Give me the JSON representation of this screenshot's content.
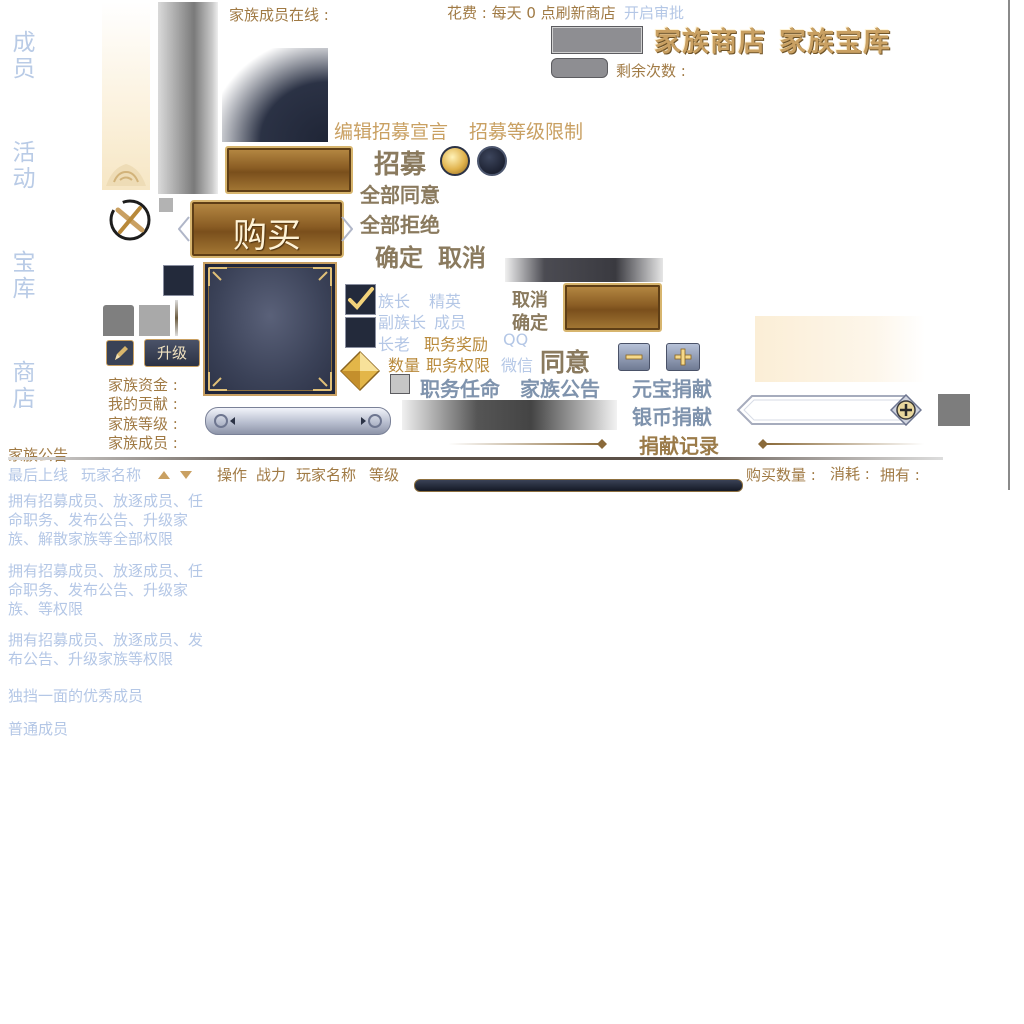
{
  "left_tabs": [
    {
      "chars": [
        "成",
        "员"
      ]
    },
    {
      "chars": [
        "活",
        "动"
      ]
    },
    {
      "chars": [
        "宝",
        "库"
      ]
    },
    {
      "chars": [
        "商",
        "店"
      ]
    }
  ],
  "header": {
    "online_label": "家族成员在线 :",
    "cost_text": "花费 : 每天 0 点刷新商店",
    "open_review": "开启审批",
    "shop_title": "家族商店",
    "treasury_title": "家族宝库",
    "remaining_label": "剩余次数 :"
  },
  "recruit": {
    "edit_declaration": "编辑招募宣言",
    "level_limit": "招募等级限制",
    "recruit_label": "招募",
    "approve_all": "全部同意",
    "reject_all": "全部拒绝",
    "buy": "购买",
    "confirm": "确定",
    "cancel": "取消"
  },
  "roles": {
    "leader": "族长",
    "elite": "精英",
    "vice_leader": "副族长",
    "member": "成员",
    "elder": "长老",
    "position_reward": "职务奖励",
    "qq": "QQ",
    "quantity": "数量",
    "position_perm": "职务权限",
    "wechat": "微信"
  },
  "dialog": {
    "cancel_small": "取消",
    "confirm_small": "确定",
    "agree": "同意",
    "appoint": "职务任命",
    "announcement_tab": "家族公告",
    "yuanbao_donate": "元宝捐献",
    "silver_donate": "银币捐献",
    "donate_record": "捐献记录"
  },
  "controls": {
    "upgrade": "升级"
  },
  "family_info": {
    "funds": "家族资金 :",
    "my_contribution": "我的贡献 :",
    "level": "家族等级 :",
    "members": "家族成员 :",
    "announcement": "家族公告"
  },
  "member_list": {
    "last_online": "最后上线",
    "player_name": "玩家名称",
    "headers": [
      "操作",
      "战力",
      "玩家名称",
      "等级"
    ]
  },
  "shop": {
    "buy_qty": "购买数量 :",
    "consume": "消耗 :",
    "own": "拥有 :"
  },
  "permissions": [
    "拥有招募成员、放逐成员、任命职务、发布公告、升级家族、解散家族等全部权限",
    "拥有招募成员、放逐成员、任命职务、发布公告、升级家族、等权限",
    "拥有招募成员、放逐成员、发布公告、升级家族等权限",
    "独挡一面的优秀成员",
    "普通成员"
  ],
  "colors": {
    "gold_text": "#b8893a",
    "tab_blue": "#b9cbe6",
    "gold_button": "#9a6c2c",
    "dark_navy": "#1f2536"
  }
}
